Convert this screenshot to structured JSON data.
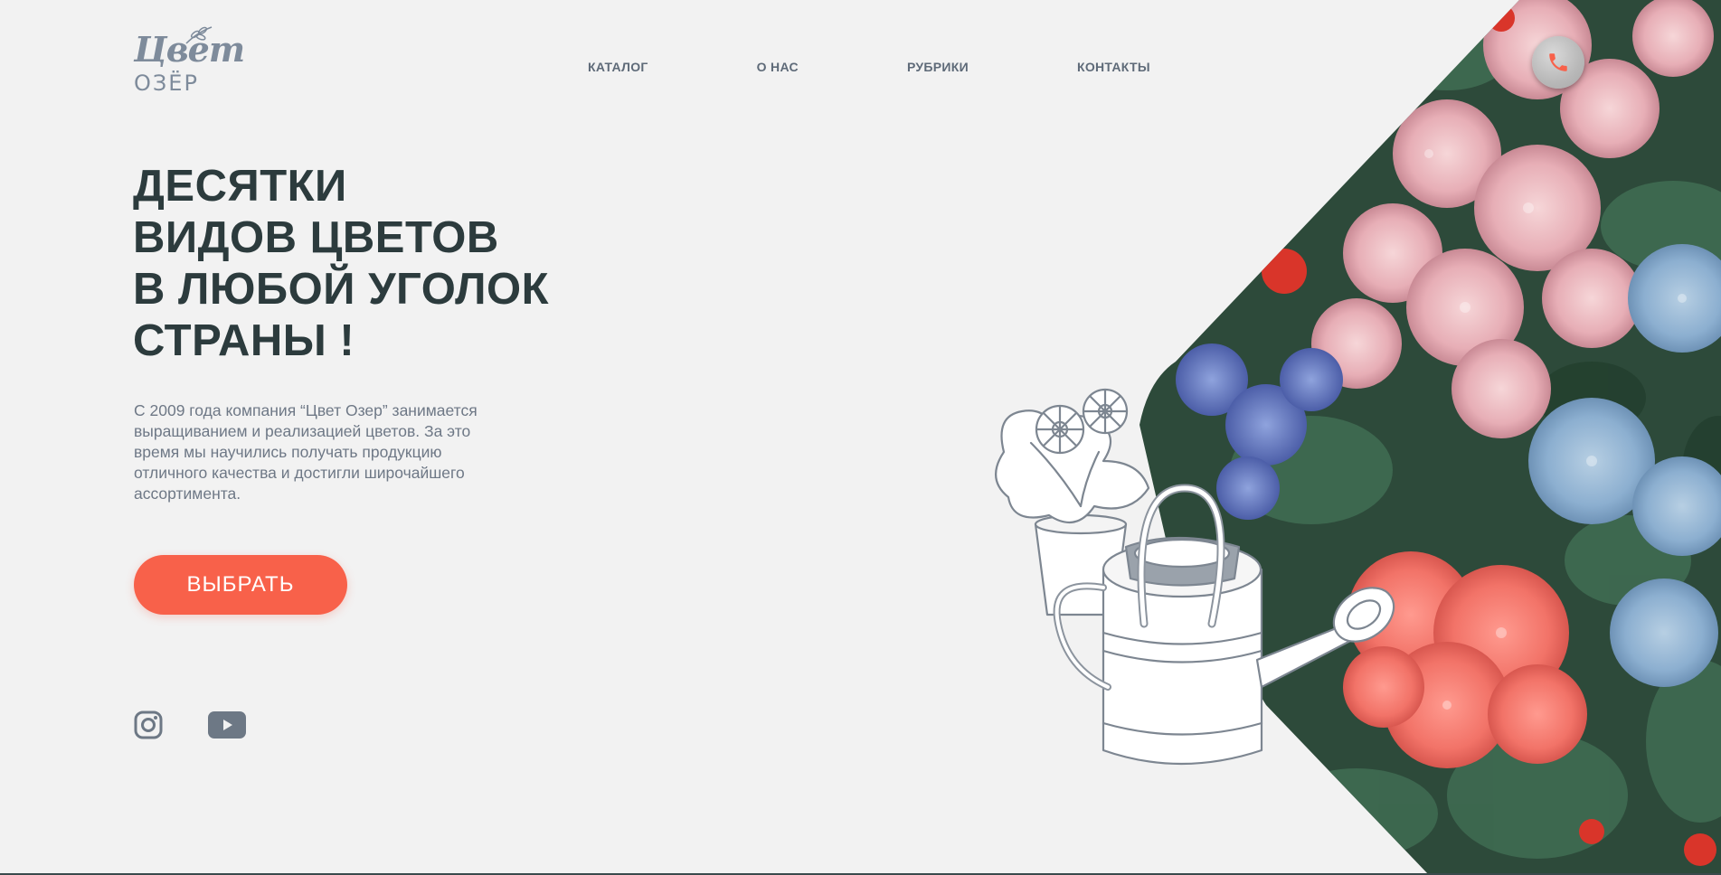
{
  "brand": {
    "logo_script": "Цвет",
    "logo_caps": "ОЗЁР"
  },
  "nav": {
    "items": [
      {
        "label": "КАТАЛОГ"
      },
      {
        "label": "О НАС"
      },
      {
        "label": "РУБРИКИ"
      },
      {
        "label": "КОНТАКТЫ"
      }
    ]
  },
  "header": {
    "phone_icon": "phone-icon",
    "phone_icon_color": "#f8614a"
  },
  "hero": {
    "title_lines": [
      "ДЕСЯТКИ",
      "ВИДОВ ЦВЕТОВ",
      "В ЛЮБОЙ УГОЛОК",
      "СТРАНЫ !"
    ],
    "description": "С 2009 года компания “Цвет Озер” занимается выращиванием и реализацией цветов. За это время мы научились получать продукцию отличного качества и достигли широчайшего ассортимента.",
    "cta_label": "ВЫБРАТЬ"
  },
  "social": {
    "icons": [
      "instagram-icon",
      "youtube-icon"
    ]
  },
  "colors": {
    "accent": "#f8614a",
    "heading": "#2c3b3d",
    "text": "#6e7886",
    "nav": "#5e6a78",
    "background": "#f2f2f2"
  }
}
